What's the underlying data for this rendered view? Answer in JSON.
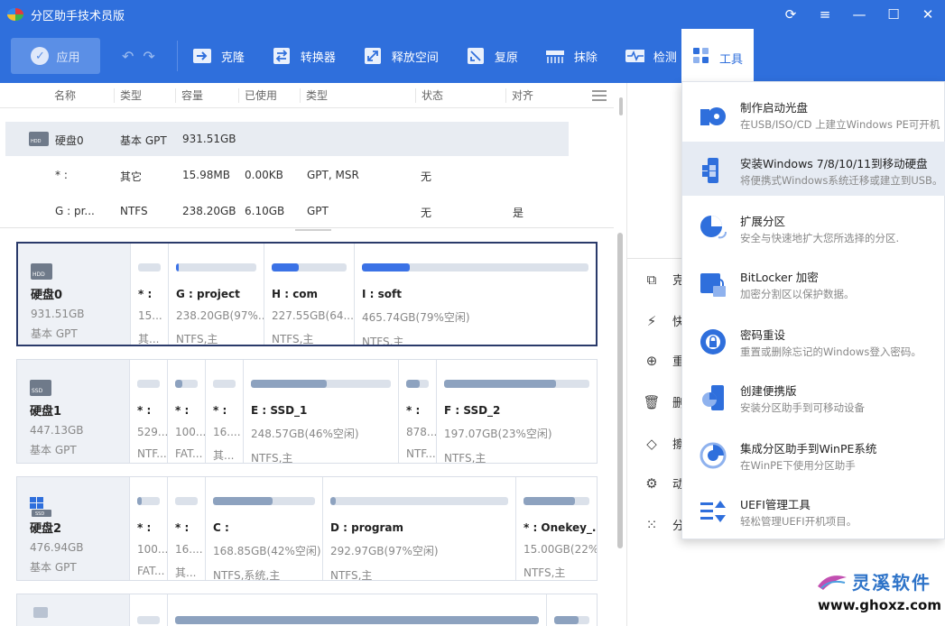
{
  "app": {
    "title": "分区助手技术员版",
    "window_controls": [
      "refresh-icon",
      "menu-icon",
      "minimize-icon",
      "maximize-icon",
      "close-icon"
    ]
  },
  "toolbar": {
    "apply_label": "应用",
    "buttons": [
      {
        "label": "克隆",
        "icon": "clone-icon"
      },
      {
        "label": "转换器",
        "icon": "convert-icon"
      },
      {
        "label": "释放空间",
        "icon": "free-space-icon"
      },
      {
        "label": "复原",
        "icon": "restore-icon"
      },
      {
        "label": "抹除",
        "icon": "wipe-icon"
      },
      {
        "label": "检测",
        "icon": "check-icon"
      },
      {
        "label": "工具",
        "icon": "tools-icon"
      }
    ]
  },
  "table": {
    "columns": [
      "名称",
      "类型",
      "容量",
      "已使用",
      "类型",
      "状态",
      "对齐"
    ],
    "rows": [
      {
        "name": "硬盘0",
        "type": "基本 GPT",
        "capacity": "931.51GB",
        "used": "",
        "fs": "",
        "status": "",
        "align": ""
      },
      {
        "name": "* :",
        "type": "其它",
        "capacity": "15.98MB",
        "used": "0.00KB",
        "fs": "GPT, MSR",
        "status": "无",
        "align": ""
      },
      {
        "name": "G : pr...",
        "type": "NTFS",
        "capacity": "238.20GB",
        "used": "6.10GB",
        "fs": "GPT",
        "status": "无",
        "align": "是"
      }
    ]
  },
  "disks": [
    {
      "name": "硬盘0",
      "size": "931.51GB",
      "type": "基本 GPT",
      "partitions": [
        {
          "label": "* :",
          "size": "15...",
          "fs": "其...",
          "used": 0.0
        },
        {
          "label": "G : project",
          "size": "238.20GB(97%...",
          "fs": "NTFS,主",
          "used": 0.03
        },
        {
          "label": "H : com",
          "size": "227.55GB(64...",
          "fs": "NTFS,主",
          "used": 0.36
        },
        {
          "label": "I : soft",
          "size": "465.74GB(79%空闲)",
          "fs": "NTFS,主",
          "used": 0.21
        }
      ]
    },
    {
      "name": "硬盘1",
      "size": "447.13GB",
      "type": "基本 GPT",
      "partitions": [
        {
          "label": "* :",
          "size": "529...",
          "fs": "NTF...",
          "used": 0.0
        },
        {
          "label": "* :",
          "size": "100...",
          "fs": "FAT...",
          "used": 0.3
        },
        {
          "label": "* :",
          "size": "16....",
          "fs": "其...",
          "used": 0.0
        },
        {
          "label": "E : SSD_1",
          "size": "248.57GB(46%空闲)",
          "fs": "NTFS,主",
          "used": 0.54
        },
        {
          "label": "* :",
          "size": "878...",
          "fs": "NTF...",
          "used": 0.6
        },
        {
          "label": "F : SSD_2",
          "size": "197.07GB(23%空闲)",
          "fs": "NTFS,主",
          "used": 0.77
        }
      ]
    },
    {
      "name": "硬盘2",
      "size": "476.94GB",
      "type": "基本 GPT",
      "partitions": [
        {
          "label": "* :",
          "size": "100...",
          "fs": "FAT...",
          "used": 0.2
        },
        {
          "label": "* :",
          "size": "16....",
          "fs": "其...",
          "used": 0.0
        },
        {
          "label": "C :",
          "size": "168.85GB(42%空闲)",
          "fs": "NTFS,系统,主",
          "used": 0.58
        },
        {
          "label": "D : program",
          "size": "292.97GB(97%空闲)",
          "fs": "NTFS,主",
          "used": 0.03
        },
        {
          "label": "* : Onekey_...",
          "size": "15.00GB(22%...",
          "fs": "NTFS,主",
          "used": 0.78
        }
      ]
    }
  ],
  "operations": [
    {
      "label": "克",
      "icon": "clone-partition-icon"
    },
    {
      "label": "快",
      "icon": "quick-partition-icon"
    },
    {
      "label": "重",
      "icon": "rebuild-icon"
    },
    {
      "label": "删",
      "icon": "delete-icon"
    },
    {
      "label": "擦",
      "icon": "erase-icon"
    },
    {
      "label": "动",
      "icon": "dynamic-disk-icon"
    },
    {
      "label": "分",
      "icon": "partition-icon"
    }
  ],
  "tools_menu": [
    {
      "title": "制作启动光盘",
      "desc": "在USB/ISO/CD 上建立Windows PE可开机",
      "icon": "bootable-media-icon"
    },
    {
      "title": "安装Windows 7/8/10/11到移动硬盘",
      "desc": "将便携式Windows系统迁移或建立到USB。",
      "icon": "windows-to-go-icon",
      "highlighted": true
    },
    {
      "title": "扩展分区",
      "desc": "安全与快速地扩大您所选择的分区.",
      "icon": "extend-partition-icon"
    },
    {
      "title": "BitLocker 加密",
      "desc": "加密分割区以保护数据。",
      "icon": "bitlocker-icon"
    },
    {
      "title": "密码重设",
      "desc": "重置或删除忘记的Windows登入密码。",
      "icon": "password-reset-icon"
    },
    {
      "title": "创建便携版",
      "desc": "安装分区助手到可移动设备",
      "icon": "portable-version-icon"
    },
    {
      "title": "集成分区助手到WinPE系统",
      "desc": "在WinPE下使用分区助手",
      "icon": "winpe-icon"
    },
    {
      "title": "UEFI管理工具",
      "desc": "轻松管理UEFI开机项目。",
      "icon": "uefi-manager-icon"
    }
  ],
  "watermark": {
    "brand": "灵溪软件",
    "url": "www.ghoxz.com"
  },
  "colors": {
    "accent": "#2f6fdc",
    "bar_used": "#3b72e6",
    "bar_gray": "#8da2bf"
  }
}
